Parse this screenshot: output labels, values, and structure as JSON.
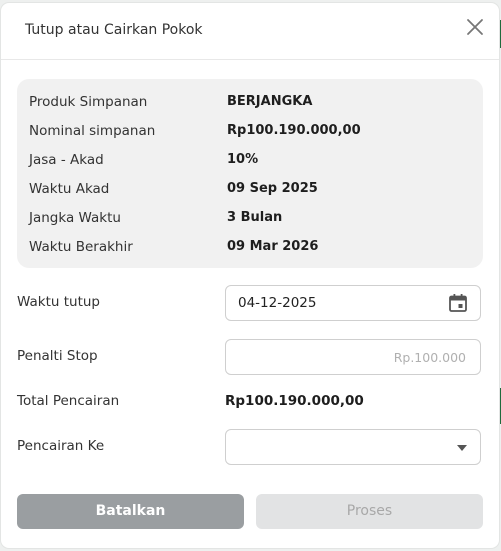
{
  "dialog": {
    "title": "Tutup atau Cairkan Pokok"
  },
  "info": [
    {
      "label": "Produk Simpanan",
      "value": "BERJANGKA"
    },
    {
      "label": "Nominal simpanan",
      "value": "Rp100.190.000,00"
    },
    {
      "label": "Jasa - Akad",
      "value": "10%"
    },
    {
      "label": "Waktu Akad",
      "value": "09 Sep 2025"
    },
    {
      "label": "Jangka Waktu",
      "value": "3 Bulan"
    },
    {
      "label": "Waktu Berakhir",
      "value": "09 Mar 2026"
    }
  ],
  "form": {
    "close_date_label": "Waktu tutup",
    "close_date_value": "04-12-2025",
    "penalty_label": "Penalti Stop",
    "penalty_placeholder": "Rp.100.000",
    "total_label": "Total Pencairan",
    "total_value": "Rp100.190.000,00",
    "disburse_to_label": "Pencairan Ke",
    "disburse_to_value": ""
  },
  "buttons": {
    "cancel_label": "Batalkan",
    "process_label": "Proses"
  },
  "colors": {
    "cancel_bg": "#9a9ea1",
    "process_bg": "#e2e3e4",
    "info_bg": "#f1f1f1",
    "edge_accent": "#1f6b3d"
  },
  "icons": {
    "close": "close-icon",
    "calendar": "calendar-icon",
    "dropdown": "chevron-down-icon"
  }
}
